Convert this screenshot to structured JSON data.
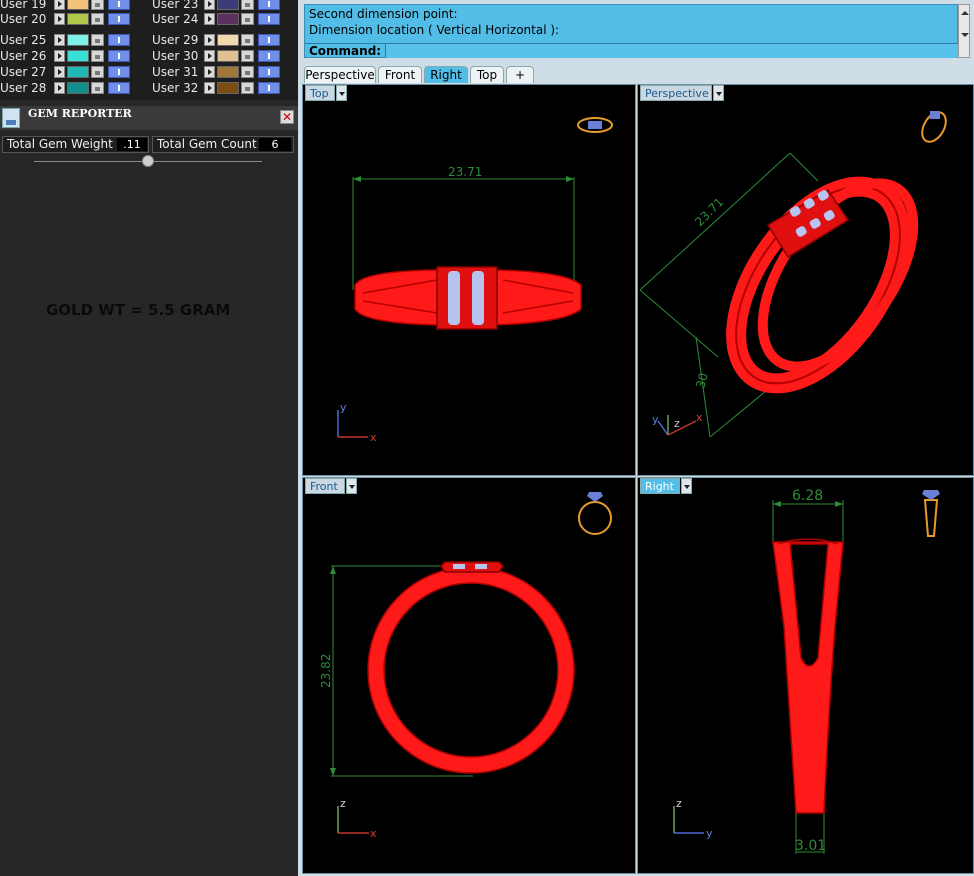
{
  "layers": [
    {
      "name": "User 19",
      "color": "#f4c27a"
    },
    {
      "name": "User 20",
      "color": "#b0c84a"
    },
    {
      "name": "User 23",
      "color": "#3c3c7a"
    },
    {
      "name": "User 24",
      "color": "#5e3060"
    },
    {
      "name": "User 25",
      "color": "#7ff0ea"
    },
    {
      "name": "User 26",
      "color": "#38e0d8"
    },
    {
      "name": "User 27",
      "color": "#20b8b0"
    },
    {
      "name": "User 28",
      "color": "#0f8e8a"
    },
    {
      "name": "User 29",
      "color": "#f0d8b0"
    },
    {
      "name": "User 30",
      "color": "#e0c090"
    },
    {
      "name": "User 31",
      "color": "#a07838"
    },
    {
      "name": "User 32",
      "color": "#7a4e14"
    }
  ],
  "gem_reporter": {
    "title": "GEM REPORTER",
    "close_symbol": "✕",
    "total_weight_label": "Total Gem Weight",
    "total_weight_value": ".11",
    "total_count_label": "Total Gem Count",
    "total_count_value": "6"
  },
  "note": "GOLD WT = 5.5 GRAM",
  "command": {
    "line1": "Second dimension point:",
    "line2": "Dimension location ( Vertical  Horizontal ):",
    "prompt_label": "Command:"
  },
  "tabs": [
    {
      "label": "Perspective",
      "active": false
    },
    {
      "label": "Front",
      "active": false
    },
    {
      "label": "Right",
      "active": true
    },
    {
      "label": "Top",
      "active": false
    },
    {
      "label": "+",
      "active": false
    }
  ],
  "viewports": {
    "top": {
      "title": "Top",
      "dimension": "23.71",
      "axis_x": "x",
      "axis_y": "y"
    },
    "perspective": {
      "title": "Perspective",
      "dimension": "23.71",
      "dimension2": "30",
      "axis_x": "x",
      "axis_y": "y",
      "axis_z": "z"
    },
    "front": {
      "title": "Front",
      "dimension": "23.82",
      "axis_x": "x",
      "axis_z": "z"
    },
    "right": {
      "title": "Right",
      "dimension_top": "6.28",
      "dimension_bottom": "3.01",
      "axis_y": "y",
      "axis_z": "z"
    }
  },
  "colors": {
    "ring": "#ff1a1a",
    "ring_dark": "#b30000",
    "gem": "#b8c4f0",
    "dimension": "#2e8b3a",
    "active_tab": "#52bde6"
  }
}
